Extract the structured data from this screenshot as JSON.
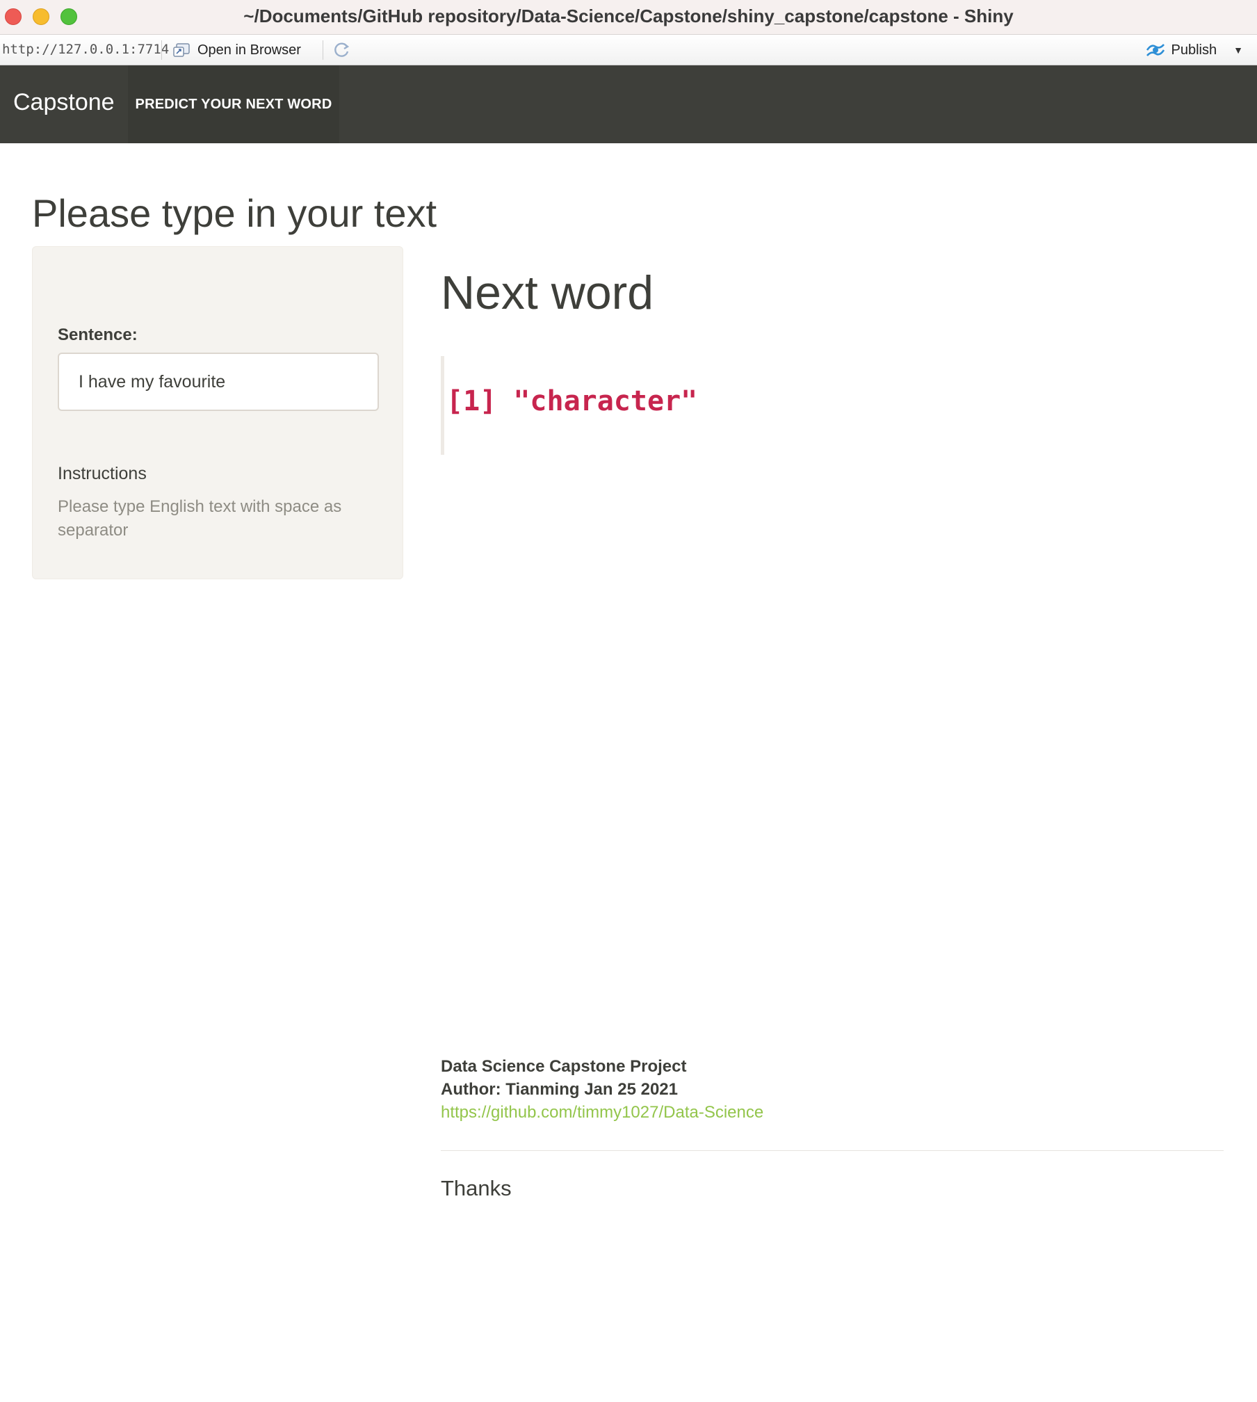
{
  "window": {
    "title": "~/Documents/GitHub repository/Data-Science/Capstone/shiny_capstone/capstone - Shiny"
  },
  "toolbar": {
    "url": "http://127.0.0.1:7714",
    "open_in_browser_label": "Open in Browser",
    "publish_label": "Publish"
  },
  "navbar": {
    "brand": "Capstone",
    "tabs": [
      {
        "label": "PREDICT YOUR NEXT WORD",
        "active": true
      }
    ]
  },
  "main": {
    "page_title": "Please type in your text",
    "sidebar": {
      "sentence_label": "Sentence:",
      "sentence_value": "I have my favourite",
      "instructions_heading": "Instructions",
      "instructions_text": "Please type English text with space as separator"
    },
    "result": {
      "heading": "Next word",
      "output": "[1] \"character\""
    },
    "footer": {
      "project": "Data Science Capstone Project",
      "author": "Author: Tianming Jan 25 2021",
      "link": "https://github.com/timmy1027/Data-Science",
      "thanks": "Thanks"
    }
  },
  "colors": {
    "navbar_bg": "#3e3f3a",
    "sidebar_bg": "#f5f3ef",
    "output_text": "#c7254e",
    "link": "#93c54b"
  }
}
